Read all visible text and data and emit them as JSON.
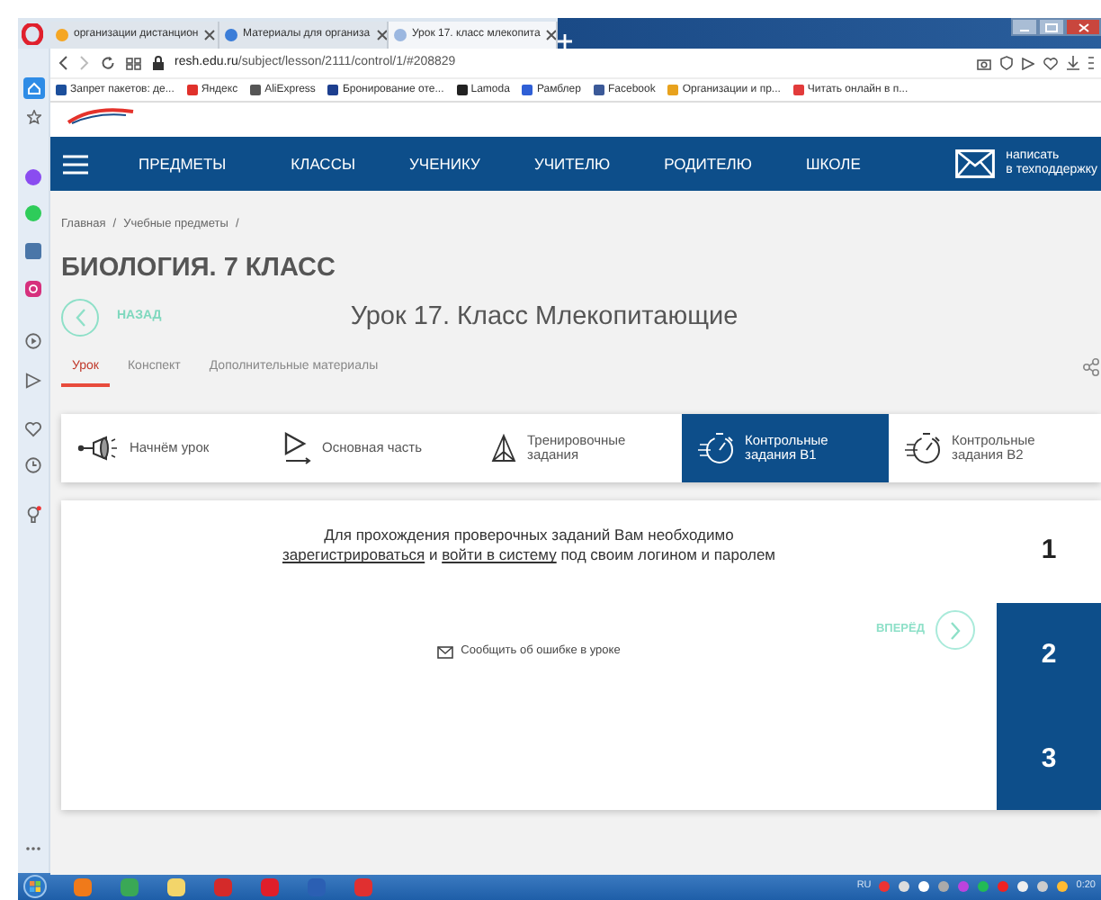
{
  "browser": {
    "tabs": [
      {
        "title": "организации дистанцион",
        "selected": false,
        "color": "#f5a623"
      },
      {
        "title": "Материалы для организа",
        "selected": false,
        "color": "#3b7dd8"
      },
      {
        "title": "Урок 17. класс млекопита",
        "selected": true,
        "color": "#9bb7e0"
      }
    ],
    "url_host": "resh.edu.ru",
    "url_path": "/subject/lesson/2111/control/1/#208829",
    "bookmarks": [
      {
        "label": "Запрет пакетов: де...",
        "color": "#1c4f9c"
      },
      {
        "label": "Яндекс",
        "color": "#e0312b"
      },
      {
        "label": "AliExpress",
        "color": "#555555"
      },
      {
        "label": "Бронирование оте...",
        "color": "#1d3f8f"
      },
      {
        "label": "Lamoda",
        "color": "#222222"
      },
      {
        "label": "Рамблер",
        "color": "#2f5fd6"
      },
      {
        "label": "Facebook",
        "color": "#3b5998"
      },
      {
        "label": "Организации и пр...",
        "color": "#e8a21d"
      },
      {
        "label": "Читать онлайн в п...",
        "color": "#e23b3b"
      }
    ]
  },
  "site": {
    "nav": [
      "ПРЕДМЕТЫ",
      "КЛАССЫ",
      "УЧЕНИКУ",
      "УЧИТЕЛЮ",
      "РОДИТЕЛЮ",
      "ШКОЛЕ"
    ],
    "support": [
      "написать",
      "в техподдержку"
    ],
    "breadcrumbs": [
      "Главная",
      "Учебные предметы"
    ],
    "breadcrumb_separator": "/",
    "subject_title": "БИОЛОГИЯ. 7 КЛАСС",
    "back_label": "НАЗАД",
    "lesson_title": "Урок 17. Класс Млекопитающие",
    "lesson_tabs": [
      {
        "label": "Урок",
        "selected": true
      },
      {
        "label": "Конспект",
        "selected": false
      },
      {
        "label": "Дополнительные материалы",
        "selected": false
      }
    ],
    "steps": [
      {
        "label": "Начнём урок",
        "kind": "megaphone",
        "selected": false
      },
      {
        "label": "Основная часть",
        "kind": "play",
        "selected": false
      },
      {
        "label": "Тренировочные задания",
        "kind": "pyramid",
        "selected": false
      },
      {
        "label": "Контрольные задания B1",
        "kind": "stopwatch",
        "selected": true
      },
      {
        "label": "Контрольные задания B2",
        "kind": "stopwatch",
        "selected": false
      }
    ],
    "notice": [
      {
        "kind": "text",
        "text": "Для прохождения проверочных заданий Вам необходимо"
      },
      {
        "kind": "break"
      },
      {
        "kind": "link",
        "text": "зарегистрироваться"
      },
      {
        "kind": "text",
        "text": " и "
      },
      {
        "kind": "link",
        "text": "войти в систему"
      },
      {
        "kind": "text",
        "text": " под своим логином и паролем"
      }
    ],
    "forward_label": "ВПЕРЁД",
    "report_label": "Сообщить об ошибке в уроке",
    "tasks": [
      {
        "label": "1",
        "selected": true
      },
      {
        "label": "2",
        "selected": false
      },
      {
        "label": "3",
        "selected": false
      }
    ]
  },
  "taskbar": {
    "language": "RU",
    "clock": "0:20"
  }
}
